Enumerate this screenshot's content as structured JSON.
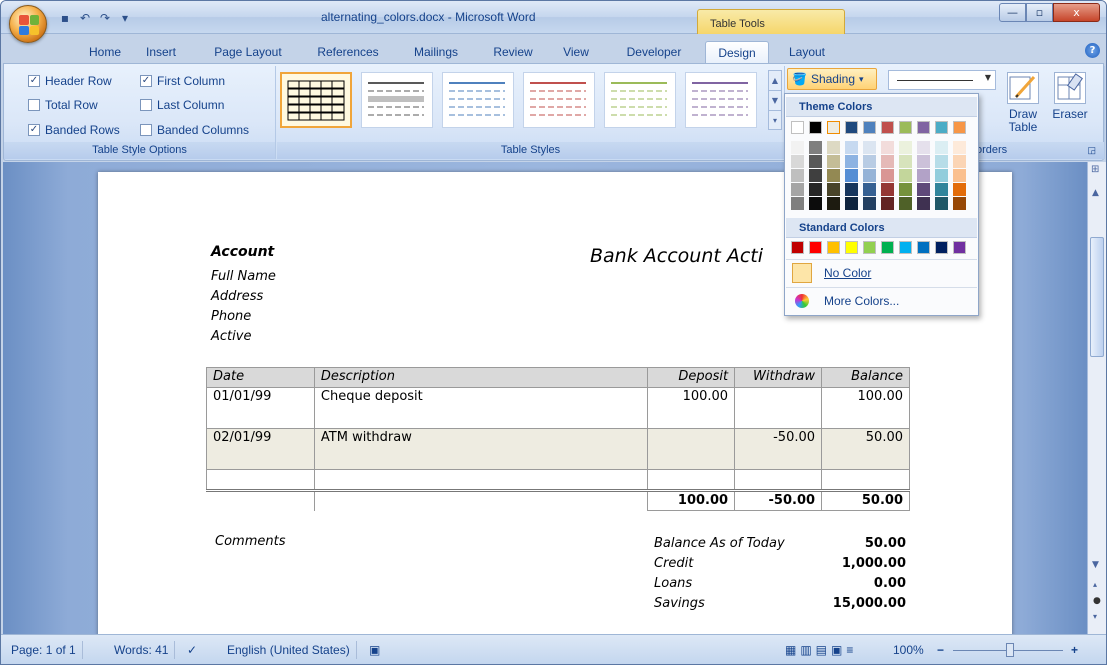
{
  "window": {
    "title": "alternating_colors.docx - Microsoft Word",
    "context_tab_group": "Table Tools",
    "minimize": "—",
    "maximize": "▫",
    "close": "x"
  },
  "quick_access": {
    "save_icon": "▪",
    "undo_icon": "↶",
    "redo_icon": "↷",
    "customize_icon": "▾"
  },
  "tabs": [
    {
      "label": "Home"
    },
    {
      "label": "Insert"
    },
    {
      "label": "Page Layout"
    },
    {
      "label": "References"
    },
    {
      "label": "Mailings"
    },
    {
      "label": "Review"
    },
    {
      "label": "View"
    },
    {
      "label": "Developer"
    },
    {
      "label": "Design"
    },
    {
      "label": "Layout"
    }
  ],
  "active_tab": "Design",
  "help": "?",
  "table_style_options": {
    "group_label": "Table Style Options",
    "options": [
      {
        "label": "Header Row",
        "checked": true
      },
      {
        "label": "First Column",
        "checked": true
      },
      {
        "label": "Total Row",
        "checked": false
      },
      {
        "label": "Last Column",
        "checked": false
      },
      {
        "label": "Banded Rows",
        "checked": true
      },
      {
        "label": "Banded Columns",
        "checked": false
      }
    ]
  },
  "table_styles": {
    "group_label": "Table Styles",
    "thumb_colors": [
      "#000000",
      "#595959",
      "#4f81bd",
      "#c0504d",
      "#9bbb59",
      "#8064a2"
    ]
  },
  "shading": {
    "label": "Shading",
    "arrow": "▾"
  },
  "draw_borders": {
    "draw_table": "Draw Table",
    "eraser": "Eraser",
    "group_label_visible": "orders"
  },
  "shading_menu": {
    "theme_colors_label": "Theme Colors",
    "theme_top_row": [
      "#ffffff",
      "#000000",
      "#eeece1",
      "#1f497d",
      "#4f81bd",
      "#c0504d",
      "#9bbb59",
      "#8064a2",
      "#4bacc6",
      "#f79646"
    ],
    "theme_shades": [
      [
        "#f2f2f2",
        "#7f7f7f",
        "#ddd9c3",
        "#c6d9f0",
        "#dbe5f1",
        "#f2dcdb",
        "#ebf1dd",
        "#e5e0ec",
        "#dbeef3",
        "#fdeada"
      ],
      [
        "#d8d8d8",
        "#595959",
        "#c4bd97",
        "#8db3e2",
        "#b8cce4",
        "#e5b9b7",
        "#d7e3bc",
        "#ccc1d9",
        "#b7dde8",
        "#fbd5b5"
      ],
      [
        "#bfbfbf",
        "#3f3f3f",
        "#938953",
        "#548dd4",
        "#95b3d7",
        "#d99694",
        "#c3d69b",
        "#b2a2c7",
        "#92cddc",
        "#fac08f"
      ],
      [
        "#a5a5a5",
        "#262626",
        "#494429",
        "#17365d",
        "#366092",
        "#953734",
        "#76923c",
        "#5f497a",
        "#31859b",
        "#e36c09"
      ],
      [
        "#7f7f7f",
        "#0c0c0c",
        "#1d1b10",
        "#0f243e",
        "#244061",
        "#632423",
        "#4f6128",
        "#3f3151",
        "#205867",
        "#974806"
      ]
    ],
    "standard_colors_label": "Standard Colors",
    "standard_colors": [
      "#c00000",
      "#ff0000",
      "#ffc000",
      "#ffff00",
      "#92d050",
      "#00b050",
      "#00b0f0",
      "#0070c0",
      "#002060",
      "#7030a0"
    ],
    "no_color": "No Color",
    "more_colors": "More Colors..."
  },
  "document": {
    "heading": "Account",
    "fields": [
      "Full Name",
      "Address",
      "Phone",
      "Active"
    ],
    "title": "Bank Account Acti",
    "table": {
      "headers": [
        "Date",
        "Description",
        "Deposit",
        "Withdraw",
        "Balance"
      ],
      "rows": [
        [
          "01/01/99",
          "Cheque deposit",
          "100.00",
          "",
          "100.00"
        ],
        [
          "02/01/99",
          "ATM withdraw",
          "",
          "-50.00",
          "50.00"
        ],
        [
          "",
          "",
          "",
          "",
          ""
        ]
      ],
      "totals": [
        "",
        "",
        "100.00",
        "-50.00",
        "50.00"
      ]
    },
    "comments_label": "Comments",
    "summary": [
      {
        "label": "Balance As of Today",
        "value": "50.00"
      },
      {
        "label": "Credit",
        "value": "1,000.00"
      },
      {
        "label": "Loans",
        "value": "0.00"
      },
      {
        "label": "Savings",
        "value": "15,000.00"
      }
    ]
  },
  "status": {
    "page": "Page: 1 of 1",
    "words": "Words: 41",
    "language": "English (United States)",
    "zoom": "100%",
    "zoom_minus": "−",
    "zoom_plus": "+"
  }
}
